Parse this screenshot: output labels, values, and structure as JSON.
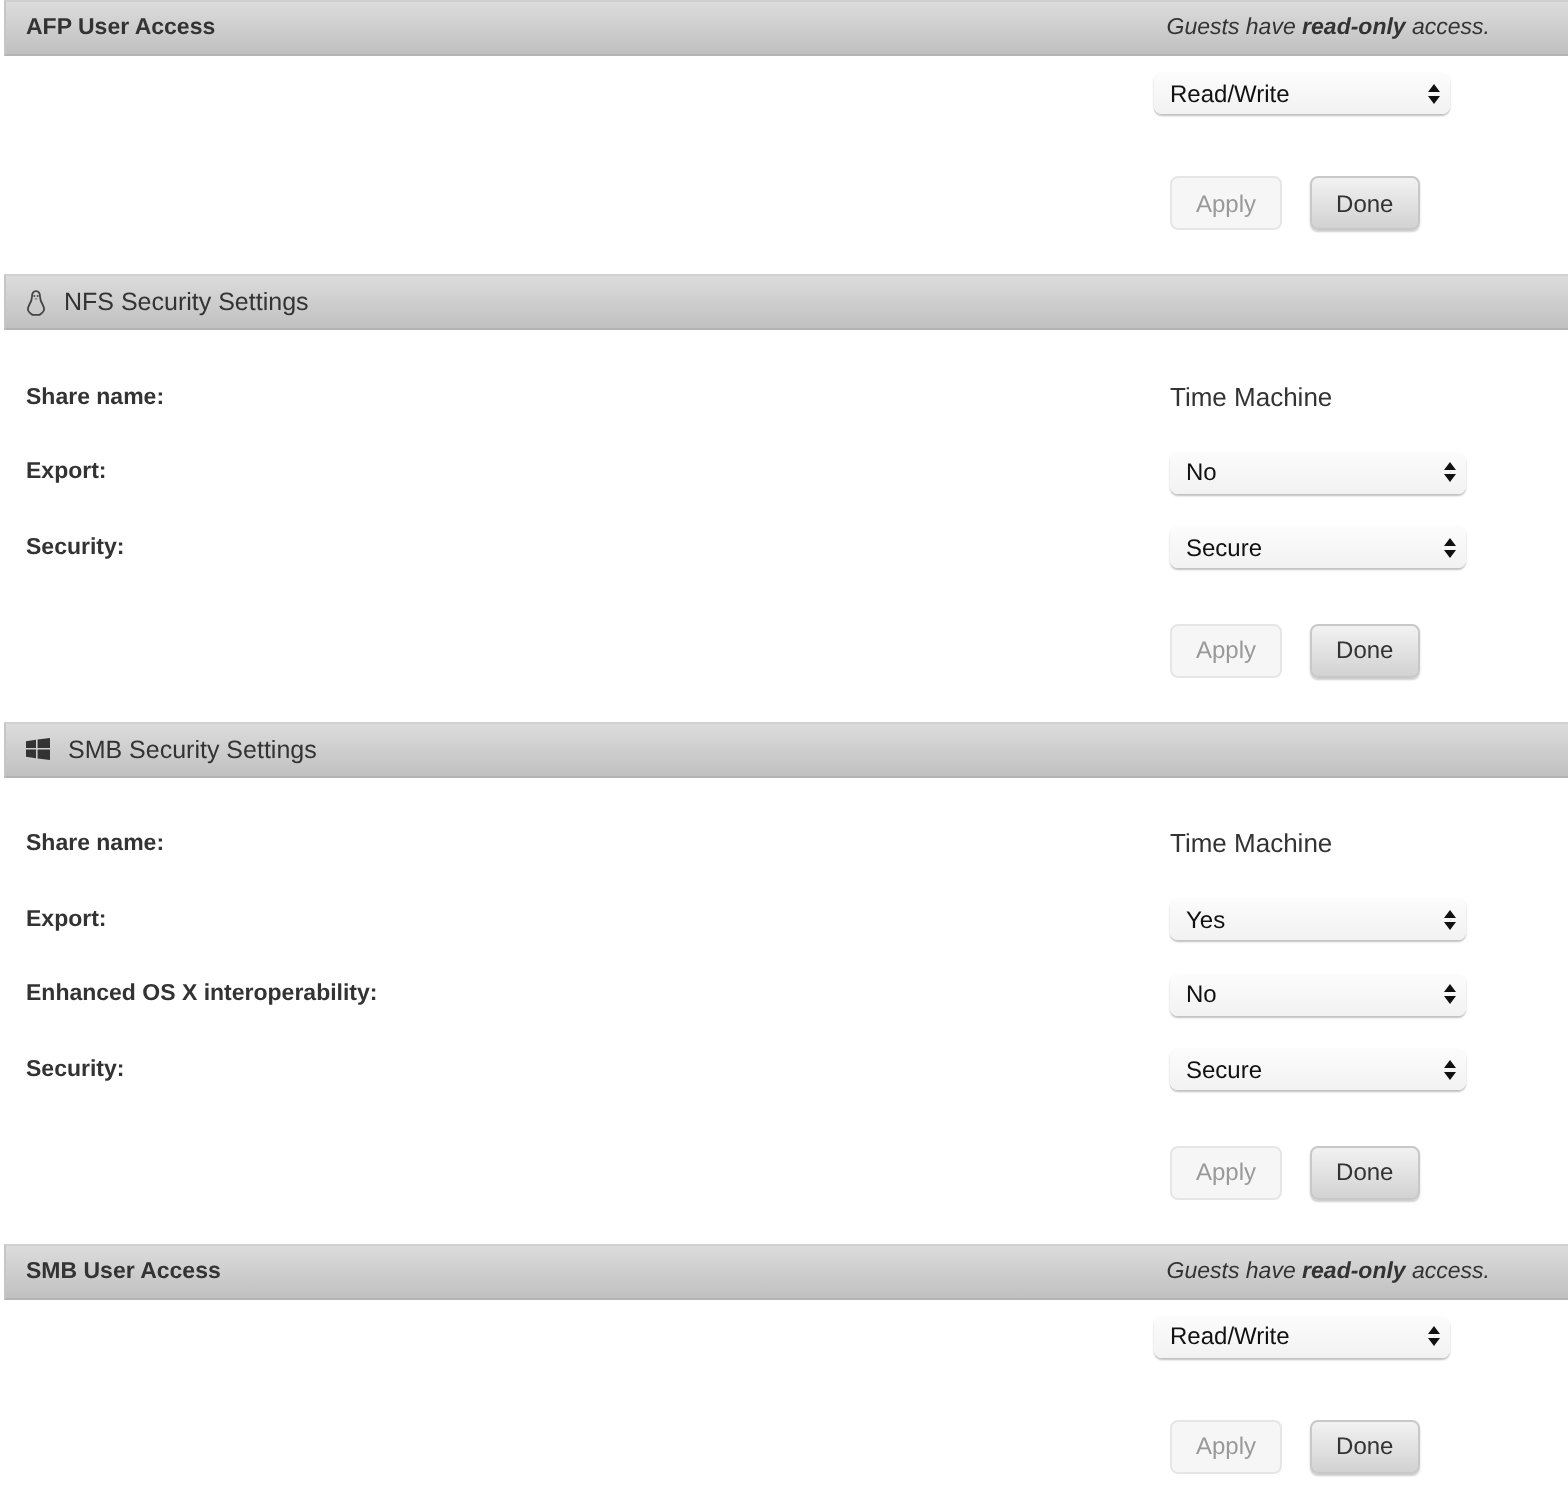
{
  "sections": [
    {
      "kind": "access",
      "title": "AFP User Access",
      "note": "Guests have **read-only** access.",
      "rows": [
        {
          "kind": "select",
          "value": "Read/Write"
        }
      ],
      "buttons": [
        {
          "label": "Apply",
          "disabled": true
        },
        {
          "label": "Done",
          "disabled": false
        }
      ]
    },
    {
      "kind": "nfs",
      "title": "NFS Security Settings",
      "rows": [
        {
          "kind": "text",
          "label": "Share name:",
          "value": "Time Machine"
        },
        {
          "kind": "select",
          "label": "Export:",
          "value": "No"
        },
        {
          "kind": "select",
          "label": "Security:",
          "value": "Secure"
        }
      ],
      "buttons": [
        {
          "label": "Apply",
          "disabled": true
        },
        {
          "label": "Done",
          "disabled": false
        }
      ]
    },
    {
      "kind": "smb",
      "title": "SMB Security Settings",
      "rows": [
        {
          "kind": "text",
          "label": "Share name:",
          "value": "Time Machine"
        },
        {
          "kind": "select",
          "label": "Export:",
          "value": "Yes"
        },
        {
          "kind": "select",
          "label": "Enhanced OS X interoperability:",
          "value": "No"
        },
        {
          "kind": "select",
          "label": "Security:",
          "value": "Secure"
        }
      ],
      "buttons": [
        {
          "label": "Apply",
          "disabled": true
        },
        {
          "label": "Done",
          "disabled": false
        }
      ]
    },
    {
      "kind": "access",
      "title": "SMB User Access",
      "note": "Guests have **read-only** access.",
      "rows": [
        {
          "kind": "select",
          "value": "Read/Write"
        }
      ],
      "buttons": [
        {
          "label": "Apply",
          "disabled": true
        },
        {
          "label": "Done",
          "disabled": false
        }
      ]
    }
  ]
}
